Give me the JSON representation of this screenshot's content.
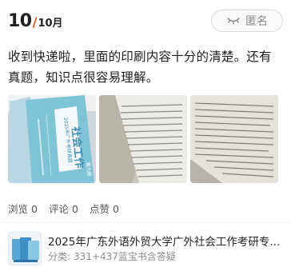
{
  "header": {
    "date_day": "10",
    "date_sep": "/",
    "date_month": "10月",
    "anonymous_label": "匿名"
  },
  "review": {
    "text": "收到快递啦，里面的印刷内容十分的清楚。还有真题，知识点很容易理解。"
  },
  "photo1": {
    "title": "社会工作",
    "subtitle": "2025年广外考研真题",
    "side_text": "第九版"
  },
  "stats": {
    "views_label": "浏览",
    "views_count": "0",
    "comments_label": "评论",
    "comments_count": "0",
    "likes_label": "点赞",
    "likes_count": "0"
  },
  "product": {
    "title": "2025年广东外语外贸大学广外社会工作考研专...",
    "category_label": "分类:",
    "category_value": "331+437蓝宝书含答疑"
  },
  "colors": {
    "accent": "#e8501e",
    "book_cover": "#7fc3d6",
    "page_bg": "#ffffff"
  }
}
